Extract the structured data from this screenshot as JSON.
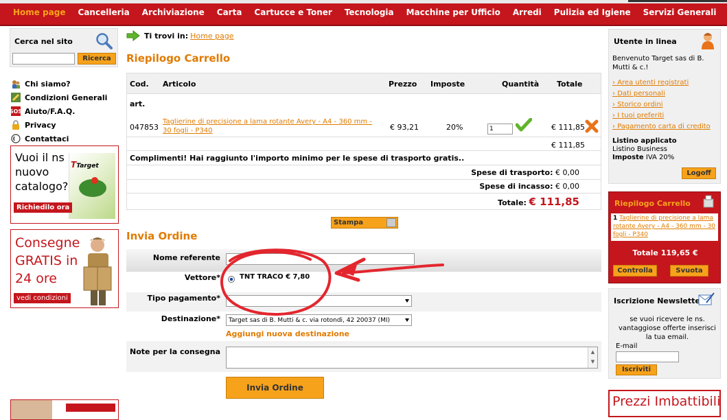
{
  "nav": {
    "items": [
      "Home page",
      "Cancelleria",
      "Archiviazione",
      "Carta",
      "Cartucce e Toner",
      "Tecnologia",
      "Macchine per Ufficio",
      "Arredi",
      "Pulizia ed Igiene",
      "Servizi Generali"
    ]
  },
  "search": {
    "title": "Cerca nel sito",
    "button": "Ricerca"
  },
  "left_links": [
    "Chi siamo?",
    "Condizioni Generali",
    "Aiuto/F.A.Q.",
    "Privacy",
    "Contattaci"
  ],
  "promo_catalog": {
    "text": "Vuoi il ns nuovo catalogo?",
    "brand": "Target",
    "cta": "Richiedilo ora"
  },
  "promo_delivery": {
    "text": "Consegne GRATIS in 24 ore",
    "cta": "vedi condizioni"
  },
  "breadcrumb": {
    "prefix": "Ti trovi in:",
    "link": "Home page"
  },
  "cart": {
    "title": "Riepilogo Carrello",
    "columns": {
      "cod": "Cod.",
      "articolo": "Articolo",
      "prezzo": "Prezzo",
      "imposte": "Imposte",
      "quantita": "Quantità",
      "totale": "Totale"
    },
    "sub_header": "art.",
    "row": {
      "cod": "047853",
      "articolo": "Taglierine di precisione a lama rotante Avery - A4 - 360 mm - 30 fogli - P340",
      "prezzo": "€ 93,21",
      "imposte": "20%",
      "qty": "1",
      "totale": "€ 111,85"
    },
    "subtotal": "€ 111,85",
    "message": "Complimenti! Hai raggiunto l'importo minimo per le spese di trasporto gratis..",
    "spese_trasporto_label": "Spese di trasporto:",
    "spese_trasporto": "€ 0,00",
    "spese_incasso_label": "Spese di incasso:",
    "spese_incasso": "€ 0,00",
    "totale_label": "Totale:",
    "totale": "€ 111,85",
    "stampa": "Stampa"
  },
  "order": {
    "title": "Invia Ordine",
    "nome_referente_label": "Nome referente",
    "vettore_label": "Vettore*",
    "vettore_option": "TNT TRACO € 7,80",
    "tipo_pagamento_label": "Tipo pagamento*",
    "destinazione_label": "Destinazione*",
    "destinazione_value": "Target sas di B. Mutti & c. via rotondi, 42 20037 (MI)",
    "aggiungi": "Aggiungi nuova destinazione",
    "note_label": "Note per la consegna",
    "submit": "Invia Ordine"
  },
  "user": {
    "title": "Utente in linea",
    "welcome": "Benvenuto Target sas di B. Mutti & c.!",
    "links": [
      "Area utenti registrati",
      "Dati personali",
      "Storico ordini",
      "I tuoi preferiti",
      "Pagamento carta di credito"
    ],
    "listino_label": "Listino applicato",
    "listino": "Listino Business",
    "imposte_label": "Imposte",
    "imposte": "IVA 20%",
    "logoff": "Logoff"
  },
  "mini_cart": {
    "title": "Riepilogo Carrello",
    "item_qty": "1",
    "item": "Taglierine di precisione a lama rotante Avery - A4 - 360 mm - 30 fogli - P340",
    "totale": "Totale 119,65 €",
    "controlla": "Controlla",
    "svuota": "Svuota"
  },
  "newsletter": {
    "title": "Iscrizione Newsletter",
    "desc": "se vuoi ricevere le ns. vantaggiose offerte inserisci la tua email.",
    "email_label": "E-mail",
    "button": "Iscriviti"
  },
  "banner_prezzi": "Prezzi Imbattibili",
  "colors": {
    "brand_red": "#c4161c",
    "accent_orange": "#f7a21b",
    "link_orange": "#e07b00"
  }
}
